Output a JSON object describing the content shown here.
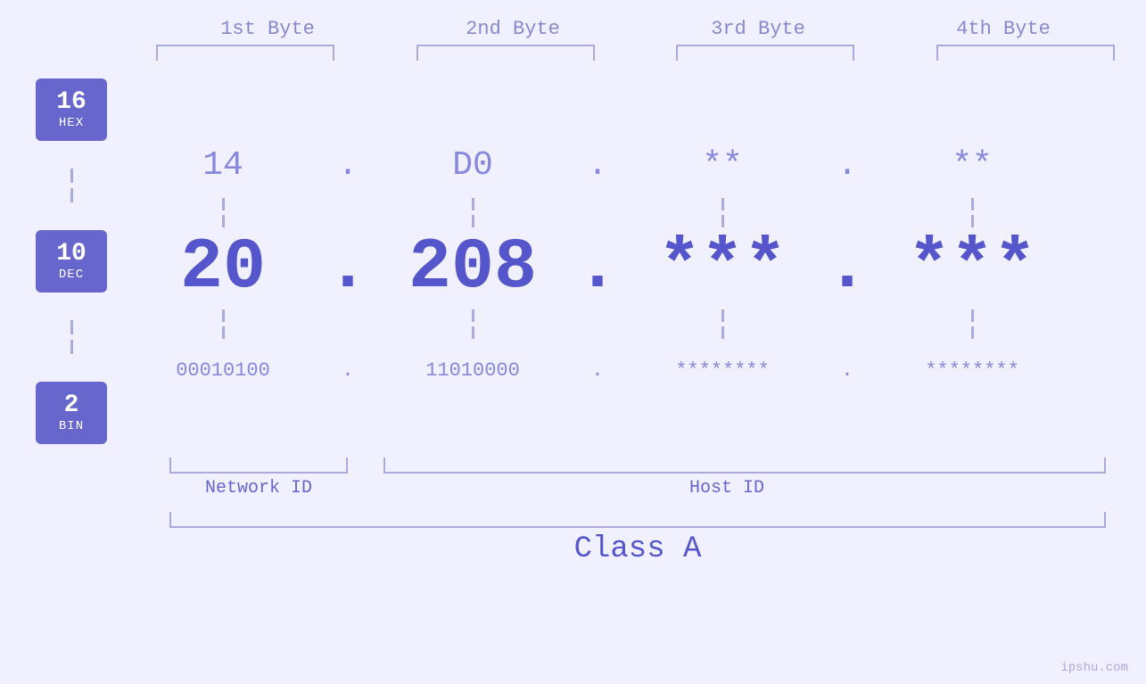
{
  "bytes": {
    "headers": [
      "1st Byte",
      "2nd Byte",
      "3rd Byte",
      "4th Byte"
    ]
  },
  "bases": [
    {
      "num": "16",
      "name": "HEX"
    },
    {
      "num": "10",
      "name": "DEC"
    },
    {
      "num": "2",
      "name": "BIN"
    }
  ],
  "values": {
    "hex": [
      "14",
      "D0",
      "**",
      "**"
    ],
    "dec": [
      "20",
      "208",
      "***",
      "***"
    ],
    "bin": [
      "00010100",
      "11010000",
      "********",
      "********"
    ]
  },
  "dots": [
    "."
  ],
  "labels": {
    "network_id": "Network ID",
    "host_id": "Host ID",
    "class": "Class A"
  },
  "watermark": "ipshu.com"
}
